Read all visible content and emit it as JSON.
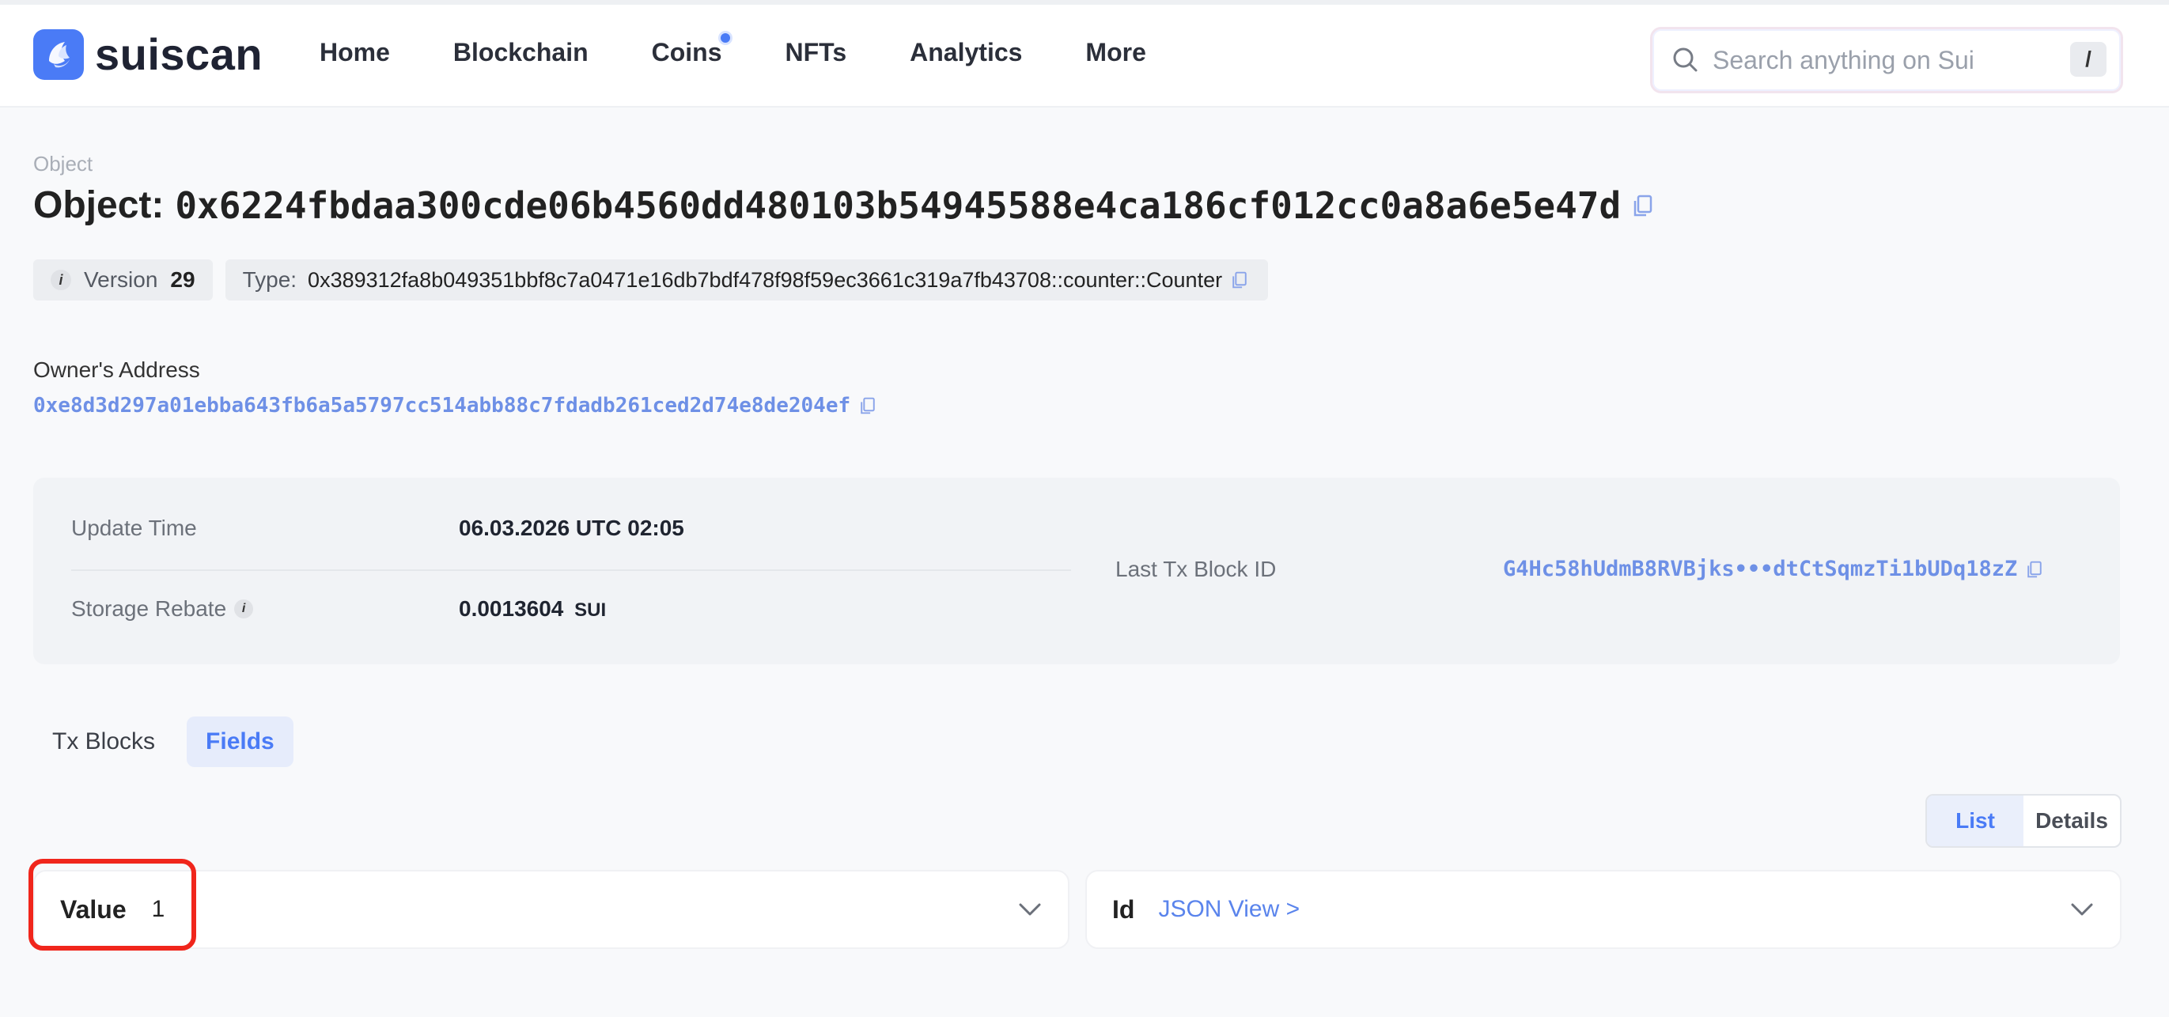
{
  "header": {
    "brand": "suiscan",
    "nav": [
      {
        "label": "Home"
      },
      {
        "label": "Blockchain"
      },
      {
        "label": "Coins",
        "dot": true
      },
      {
        "label": "NFTs"
      },
      {
        "label": "Analytics"
      },
      {
        "label": "More"
      }
    ],
    "search": {
      "placeholder": "Search anything on Sui",
      "shortcut": "/"
    }
  },
  "object": {
    "breadcrumb": "Object",
    "title_label": "Object:",
    "id": "0x6224fbdaa300cde06b4560dd480103b54945588e4ca186cf012cc0a8a6e5e47d",
    "version_label": "Version",
    "version": "29",
    "type_label": "Type:",
    "type": "0x389312fa8b049351bbf8c7a0471e16db7bdf478f98f59ec3661c319a7fb43708::counter::Counter",
    "owner_label": "Owner's Address",
    "owner_address": "0xe8d3d297a01ebba643fb6a5a5797cc514abb88c7fdadb261ced2d74e8de204ef"
  },
  "details": {
    "update_time_label": "Update Time",
    "update_time": "06.03.2026 UTC 02:05",
    "storage_rebate_label": "Storage Rebate",
    "storage_rebate": "0.0013604",
    "storage_rebate_unit": "SUI",
    "last_tx_label": "Last Tx Block ID",
    "last_tx": "G4Hc58hUdmB8RVBjks•••dtCtSqmzTi1bUDq18zZ"
  },
  "tabs": [
    {
      "label": "Tx Blocks",
      "active": false
    },
    {
      "label": "Fields",
      "active": true
    }
  ],
  "view_toggle": {
    "list": "List",
    "details": "Details",
    "active": "list"
  },
  "fields": {
    "value_key": "Value",
    "value": "1",
    "id_key": "Id",
    "id_link": "JSON View >"
  },
  "colors": {
    "accent": "#4a7bf6",
    "highlight": "#f0261c"
  }
}
